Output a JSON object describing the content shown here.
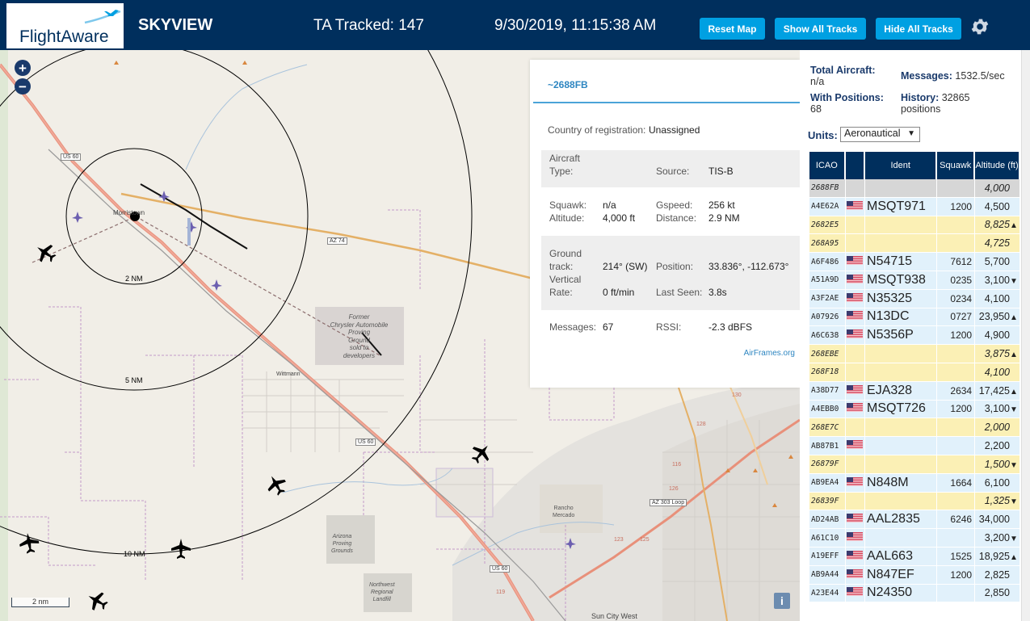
{
  "header": {
    "logo_text": "FlightAware",
    "app_title": "SKYVIEW",
    "tracked": "TA Tracked: 147",
    "clock": "9/30/2019, 11:15:38 AM",
    "buttons": {
      "reset_map": "Reset Map",
      "show_all": "Show All Tracks",
      "hide_all": "Hide All Tracks"
    }
  },
  "map": {
    "zoom_in": "+",
    "zoom_out": "−",
    "scale_label": "2 nm",
    "info_label": "i",
    "ring_labels": [
      "2 NM",
      "5 NM",
      "10 NM"
    ],
    "place_labels": {
      "morristown": "Morristown",
      "wittmann": "Wittmann",
      "former_line1": "Former",
      "former_line2": "Chrysler Automobile",
      "former_line3": "Proving",
      "former_line4": "Ground",
      "former_line5": "sold to",
      "former_line6": "developers",
      "rancho1": "Rancho",
      "rancho2": "Mercado",
      "arizona1": "Arizona",
      "arizona2": "Proving",
      "arizona3": "Grounds",
      "northwest1": "Northwest",
      "northwest2": "Regional",
      "northwest3": "Landfill",
      "sun_city": "Sun City West"
    },
    "road_labels": {
      "us60_a": "US 60",
      "us60_b": "US 60",
      "us60_c": "US 60",
      "az74": "AZ 74",
      "az303": "AZ 303 Loop",
      "r123": "123",
      "r125": "125",
      "r128": "128",
      "r130": "130",
      "r126": "126",
      "r119": "119",
      "r116": "116"
    }
  },
  "popup": {
    "ident": "~2688FB",
    "country_label": "Country of registration:",
    "country_value": "Unassigned",
    "aircraft_type_label_1": "Aircraft",
    "aircraft_type_label_2": "Type:",
    "source_label": "Source:",
    "source_value": "TIS-B",
    "squawk_label": "Squawk:",
    "squawk_value": "n/a",
    "gspeed_label": "Gspeed:",
    "gspeed_value": "256 kt",
    "altitude_label": "Altitude:",
    "altitude_value": "4,000 ft",
    "distance_label": "Distance:",
    "distance_value": "2.9 NM",
    "ground_label_1": "Ground",
    "ground_label_2": "track:",
    "ground_value": "214° (SW)",
    "position_label": "Position:",
    "position_value": "33.836°, -112.673°",
    "vertical_label_1": "Vertical",
    "vertical_label_2": "Rate:",
    "vertical_value": "0 ft/min",
    "lastseen_label": "Last Seen:",
    "lastseen_value": "3.8s",
    "messages_label": "Messages:",
    "messages_value": "67",
    "rssi_label": "RSSI:",
    "rssi_value": "-2.3 dBFS",
    "airframes_link": "AirFrames.org"
  },
  "sidebar": {
    "total_label": "Total Aircraft:",
    "total_value": "n/a",
    "messages_label": "Messages:",
    "messages_value": "1532.5/sec",
    "positions_label": "With Positions:",
    "positions_value": "68",
    "history_label": "History:",
    "history_value": "32865",
    "history_unit": "positions",
    "units_label": "Units:",
    "units_value": "Aeronautical",
    "columns": [
      "ICAO",
      "",
      "Ident",
      "Squawk",
      "Altitude (ft)"
    ],
    "rows": [
      {
        "icao": "2688FB",
        "flag": false,
        "ident": "",
        "squawk": "",
        "altitude": "4,000",
        "trend": "",
        "style": "gray"
      },
      {
        "icao": "A4E62A",
        "flag": true,
        "ident": "MSQT971",
        "squawk": "1200",
        "altitude": "4,500",
        "trend": "",
        "style": "blue"
      },
      {
        "icao": "2682E5",
        "flag": false,
        "ident": "",
        "squawk": "",
        "altitude": "8,825",
        "trend": "▲",
        "style": "yellow"
      },
      {
        "icao": "268A95",
        "flag": false,
        "ident": "",
        "squawk": "",
        "altitude": "4,725",
        "trend": "",
        "style": "yellow"
      },
      {
        "icao": "A6F486",
        "flag": true,
        "ident": "N54715",
        "squawk": "7612",
        "altitude": "5,700",
        "trend": "",
        "style": "blue"
      },
      {
        "icao": "A51A9D",
        "flag": true,
        "ident": "MSQT938",
        "squawk": "0235",
        "altitude": "3,100",
        "trend": "▼",
        "style": "blue"
      },
      {
        "icao": "A3F2AE",
        "flag": true,
        "ident": "N35325",
        "squawk": "0234",
        "altitude": "4,100",
        "trend": "",
        "style": "blue"
      },
      {
        "icao": "A07926",
        "flag": true,
        "ident": "N13DC",
        "squawk": "0727",
        "altitude": "23,950",
        "trend": "▲",
        "style": "blue"
      },
      {
        "icao": "A6C638",
        "flag": true,
        "ident": "N5356P",
        "squawk": "1200",
        "altitude": "4,900",
        "trend": "",
        "style": "blue"
      },
      {
        "icao": "268EBE",
        "flag": false,
        "ident": "",
        "squawk": "",
        "altitude": "3,875",
        "trend": "▲",
        "style": "yellow"
      },
      {
        "icao": "268F18",
        "flag": false,
        "ident": "",
        "squawk": "",
        "altitude": "4,100",
        "trend": "",
        "style": "yellow"
      },
      {
        "icao": "A38D77",
        "flag": true,
        "ident": "EJA328",
        "squawk": "2634",
        "altitude": "17,425",
        "trend": "▲",
        "style": "blue"
      },
      {
        "icao": "A4EBB0",
        "flag": true,
        "ident": "MSQT726",
        "squawk": "1200",
        "altitude": "3,100",
        "trend": "▼",
        "style": "blue"
      },
      {
        "icao": "268E7C",
        "flag": false,
        "ident": "",
        "squawk": "",
        "altitude": "2,000",
        "trend": "",
        "style": "yellow"
      },
      {
        "icao": "AB87B1",
        "flag": true,
        "ident": "",
        "squawk": "",
        "altitude": "2,200",
        "trend": "",
        "style": "blue"
      },
      {
        "icao": "26879F",
        "flag": false,
        "ident": "",
        "squawk": "",
        "altitude": "1,500",
        "trend": "▼",
        "style": "yellow"
      },
      {
        "icao": "AB9EA4",
        "flag": true,
        "ident": "N848M",
        "squawk": "1664",
        "altitude": "6,100",
        "trend": "",
        "style": "blue"
      },
      {
        "icao": "26839F",
        "flag": false,
        "ident": "",
        "squawk": "",
        "altitude": "1,325",
        "trend": "▼",
        "style": "yellow"
      },
      {
        "icao": "AD24AB",
        "flag": true,
        "ident": "AAL2835",
        "squawk": "6246",
        "altitude": "34,000",
        "trend": "",
        "style": "blue"
      },
      {
        "icao": "A61C10",
        "flag": true,
        "ident": "",
        "squawk": "",
        "altitude": "3,200",
        "trend": "▼",
        "style": "blue"
      },
      {
        "icao": "A19EFF",
        "flag": true,
        "ident": "AAL663",
        "squawk": "1525",
        "altitude": "18,925",
        "trend": "▲",
        "style": "blue"
      },
      {
        "icao": "AB9A44",
        "flag": true,
        "ident": "N847EF",
        "squawk": "1200",
        "altitude": "2,825",
        "trend": "",
        "style": "blue"
      },
      {
        "icao": "A23E44",
        "flag": true,
        "ident": "N24350",
        "squawk": "",
        "altitude": "2,850",
        "trend": "",
        "style": "blue"
      }
    ]
  },
  "colors": {
    "header_bg": "#002f5d",
    "button_bg": "#00a0e2",
    "row_blue": "#e1f1fb",
    "row_yellow": "#fbf0b5",
    "row_selected": "#d6d6d6",
    "link": "#2e86c1"
  }
}
